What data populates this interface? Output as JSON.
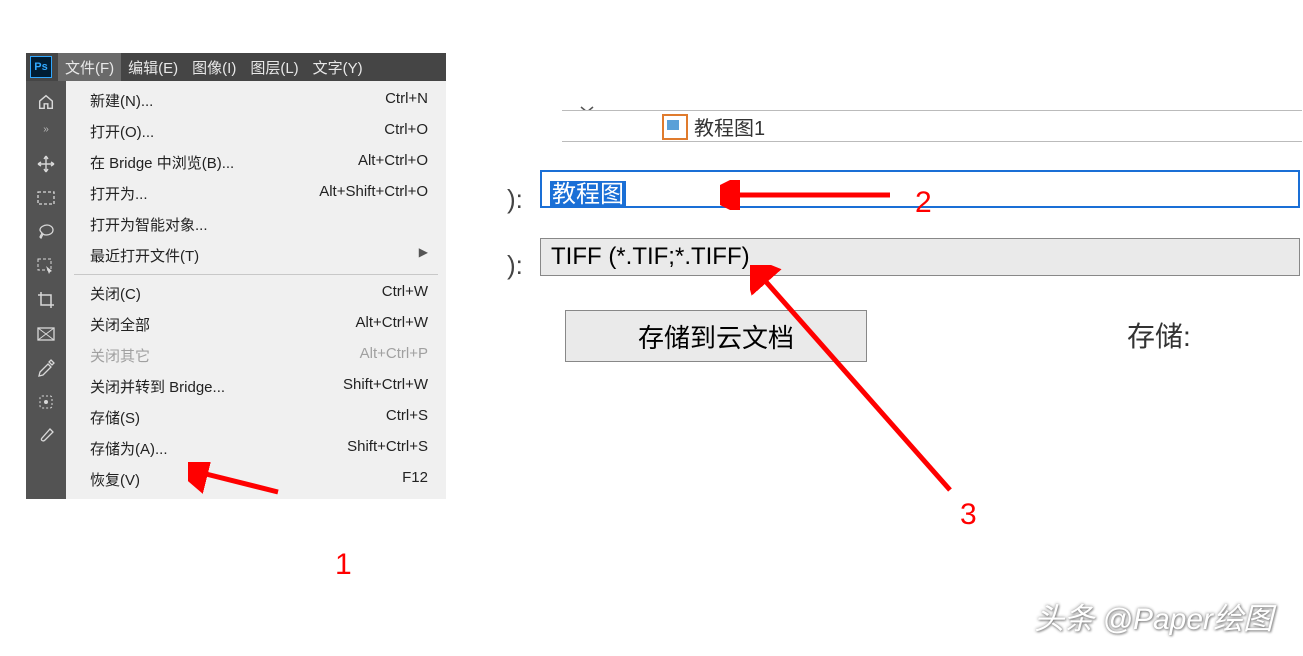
{
  "menubar": {
    "logo": "Ps",
    "items": [
      "文件(F)",
      "编辑(E)",
      "图像(I)",
      "图层(L)",
      "文字(Y)"
    ]
  },
  "toolbar_expand": "»",
  "file_menu": {
    "new": {
      "label": "新建(N)...",
      "shortcut": "Ctrl+N"
    },
    "open": {
      "label": "打开(O)...",
      "shortcut": "Ctrl+O"
    },
    "browse_bridge": {
      "label": "在 Bridge 中浏览(B)...",
      "shortcut": "Alt+Ctrl+O"
    },
    "open_as": {
      "label": "打开为...",
      "shortcut": "Alt+Shift+Ctrl+O"
    },
    "open_smart": {
      "label": "打开为智能对象...",
      "shortcut": ""
    },
    "open_recent": {
      "label": "最近打开文件(T)",
      "shortcut": ""
    },
    "close": {
      "label": "关闭(C)",
      "shortcut": "Ctrl+W"
    },
    "close_all": {
      "label": "关闭全部",
      "shortcut": "Alt+Ctrl+W"
    },
    "close_others": {
      "label": "关闭其它",
      "shortcut": "Alt+Ctrl+P"
    },
    "close_bridge": {
      "label": "关闭并转到 Bridge...",
      "shortcut": "Shift+Ctrl+W"
    },
    "save": {
      "label": "存储(S)",
      "shortcut": "Ctrl+S"
    },
    "save_as": {
      "label": "存储为(A)...",
      "shortcut": "Shift+Ctrl+S"
    },
    "revert": {
      "label": "恢复(V)",
      "shortcut": "F12"
    }
  },
  "save_dialog": {
    "partial_filename": "教程图1",
    "filename_colon": "):",
    "format_colon": "):",
    "filename": "教程图",
    "format": "TIFF (*.TIF;*.TIFF)",
    "cloud_button": "存储到云文档",
    "save_label": "存储:"
  },
  "annotations": {
    "n1": "1",
    "n2": "2",
    "n3": "3"
  },
  "watermark": "头条 @Paper绘图"
}
